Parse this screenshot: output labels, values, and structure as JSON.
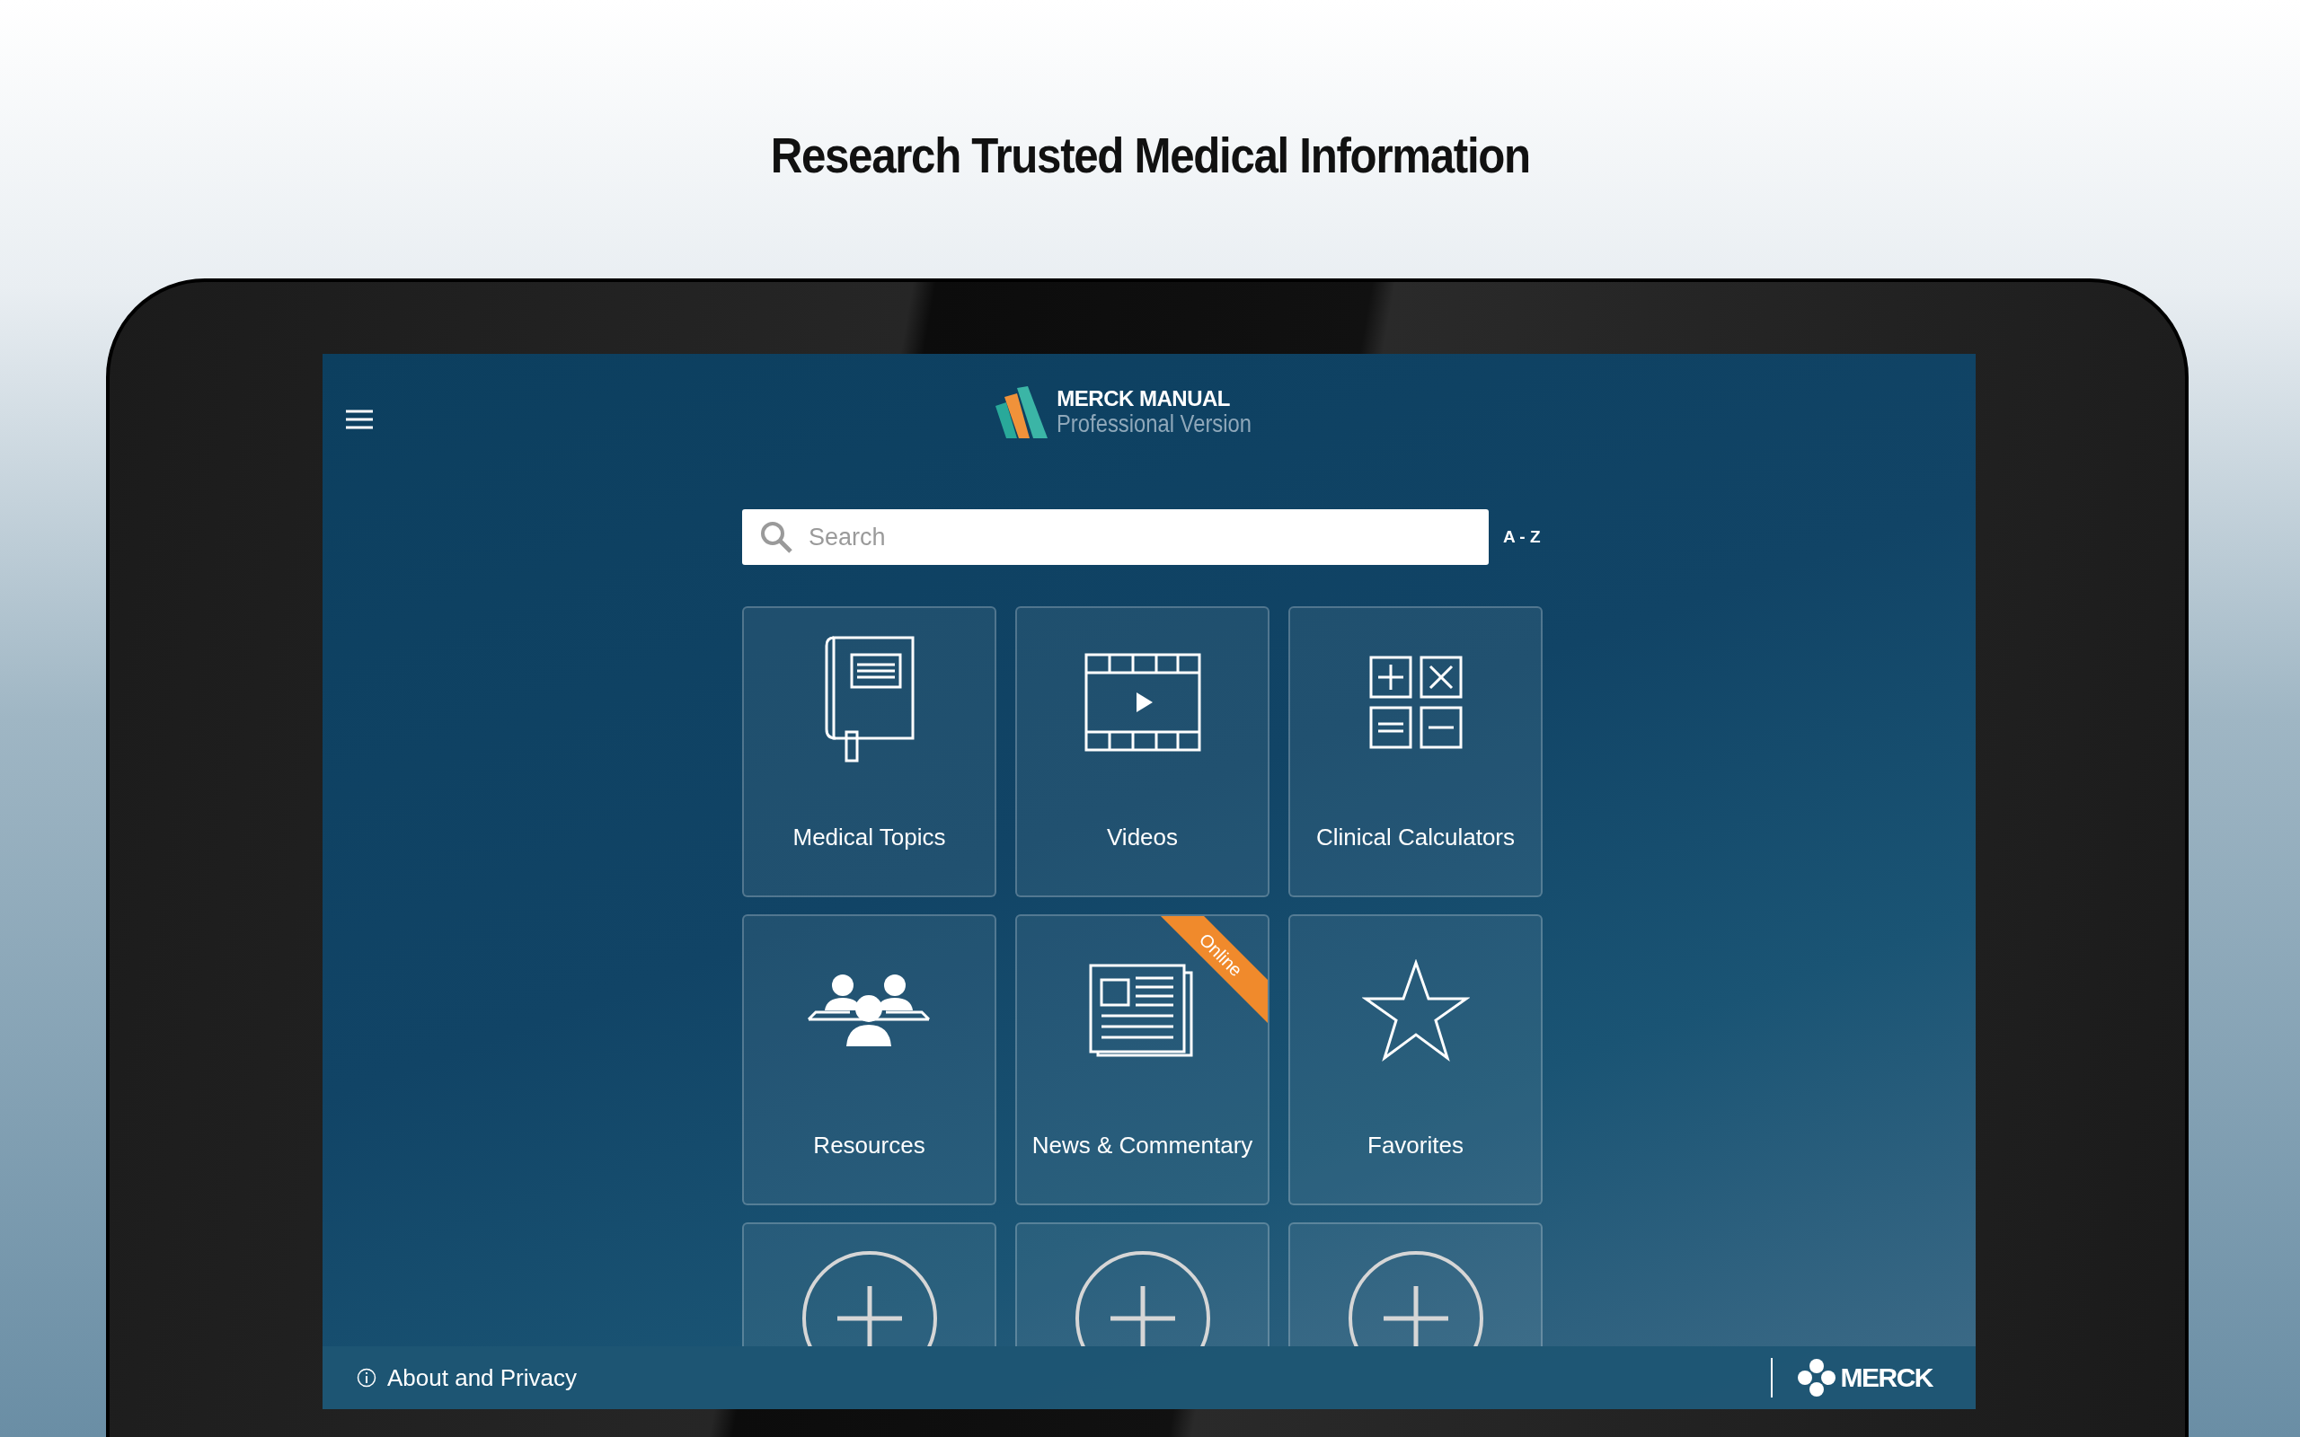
{
  "headline": "Research Trusted Medical Information",
  "app": {
    "logo": {
      "line1": "MERCK MANUAL",
      "line2": "Professional Version"
    },
    "search": {
      "placeholder": "Search",
      "index_link": "A - Z"
    },
    "tiles": [
      {
        "kind": "link",
        "label": "Medical Topics"
      },
      {
        "kind": "link",
        "label": "Videos"
      },
      {
        "kind": "link",
        "label": "Clinical Calculators"
      },
      {
        "kind": "link",
        "label": "Resources"
      },
      {
        "kind": "link",
        "label": "News & Commentary",
        "ribbon": "Online"
      },
      {
        "kind": "link",
        "label": "Favorites"
      },
      {
        "kind": "add"
      },
      {
        "kind": "add"
      },
      {
        "kind": "add"
      }
    ],
    "footer": {
      "about": "About and Privacy",
      "brand": "MERCK"
    }
  }
}
